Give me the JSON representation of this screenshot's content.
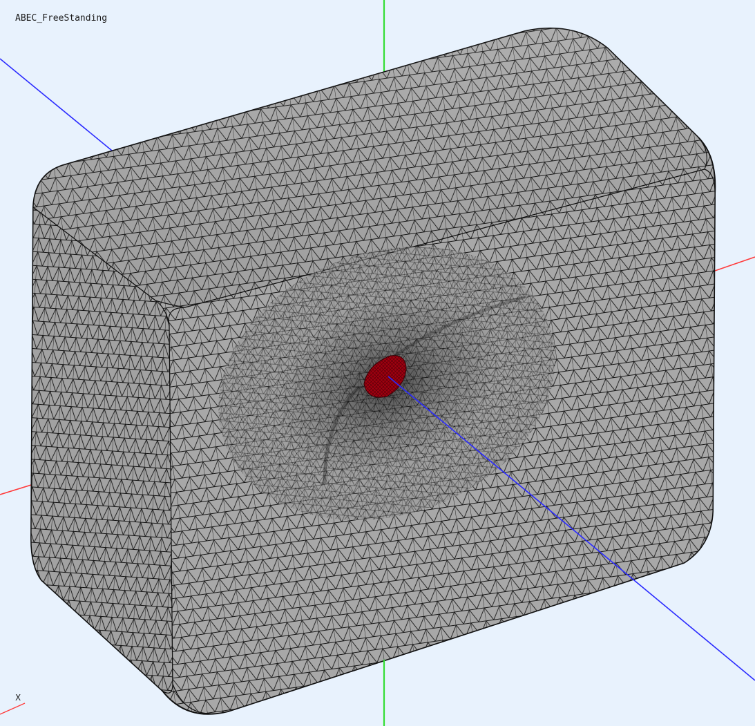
{
  "viewport": {
    "title": "ABEC_FreeStanding",
    "triad_label": "X"
  },
  "colors": {
    "background": "#e8f2fd",
    "mesh_fill": "#a8a8a8",
    "mesh_edge": "#141414",
    "driver_fill": "#a00010",
    "axis_x": "#ff3b3b",
    "axis_y": "#33dd33",
    "axis_z": "#2a2aff"
  }
}
